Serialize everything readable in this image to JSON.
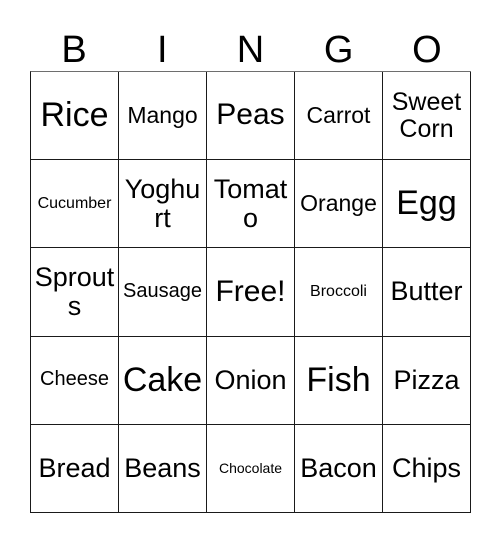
{
  "card": {
    "title": "BINGO",
    "headers": [
      "B",
      "I",
      "N",
      "G",
      "O"
    ],
    "rows": [
      [
        {
          "label": "Rice",
          "size": "xl"
        },
        {
          "label": "Mango",
          "size": "sm"
        },
        {
          "label": "Peas",
          "size": "lg"
        },
        {
          "label": "Carrot",
          "size": "sm"
        },
        {
          "label": "Sweet Corn",
          "size": "wrap"
        }
      ],
      [
        {
          "label": "Cucumber",
          "size": "xxs"
        },
        {
          "label": "Yoghurt",
          "size": "md"
        },
        {
          "label": "Tomato",
          "size": "md"
        },
        {
          "label": "Orange",
          "size": "sm"
        },
        {
          "label": "Egg",
          "size": "xl"
        }
      ],
      [
        {
          "label": "Sprouts",
          "size": "md"
        },
        {
          "label": "Sausage",
          "size": "xs"
        },
        {
          "label": "Free!",
          "size": "lg"
        },
        {
          "label": "Broccoli",
          "size": "xxs"
        },
        {
          "label": "Butter",
          "size": "md"
        }
      ],
      [
        {
          "label": "Cheese",
          "size": "xs"
        },
        {
          "label": "Cake",
          "size": "xl"
        },
        {
          "label": "Onion",
          "size": "md"
        },
        {
          "label": "Fish",
          "size": "xl"
        },
        {
          "label": "Pizza",
          "size": "md"
        }
      ],
      [
        {
          "label": "Bread",
          "size": "md"
        },
        {
          "label": "Beans",
          "size": "md"
        },
        {
          "label": "Chocolate",
          "size": "tiny"
        },
        {
          "label": "Bacon",
          "size": "md"
        },
        {
          "label": "Chips",
          "size": "md"
        }
      ]
    ],
    "free_space": {
      "row": 2,
      "column": 2,
      "label": "Free!"
    },
    "colors": {
      "background": "#ffffff",
      "text": "#000000",
      "grid_line": "#1a1a1a",
      "grid_line_top": "#6e6e6e"
    }
  }
}
